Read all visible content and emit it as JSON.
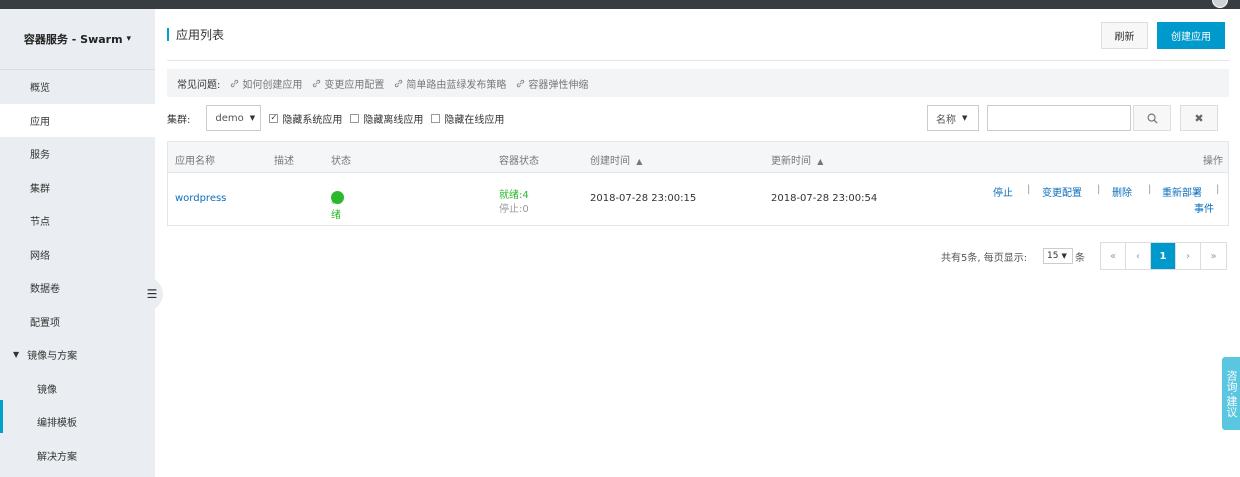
{
  "sidebar": {
    "title": "容器服务 - Swarm",
    "items": [
      "概览",
      "应用",
      "服务",
      "集群",
      "节点",
      "网络",
      "数据卷",
      "配置项"
    ],
    "group": "镜像与方案",
    "subitems": [
      "镜像",
      "编排模板",
      "解决方案"
    ]
  },
  "header": {
    "title": "应用列表",
    "refresh": "刷新",
    "create": "创建应用"
  },
  "faq": {
    "label": "常见问题:",
    "links": [
      "如何创建应用",
      "变更应用配置",
      "简单路由蓝绿发布策略",
      "容器弹性伸缩"
    ]
  },
  "filter": {
    "cluster_label": "集群:",
    "cluster_value": "demo",
    "checks": [
      {
        "label": "隐藏系统应用",
        "checked": true
      },
      {
        "label": "隐藏离线应用",
        "checked": false
      },
      {
        "label": "隐藏在线应用",
        "checked": false
      }
    ],
    "search_type": "名称",
    "search_value": ""
  },
  "table": {
    "headers": {
      "name": "应用名称",
      "desc": "描述",
      "status": "状态",
      "container": "容器状态",
      "created": "创建时间",
      "updated": "更新时间",
      "ops": "操作"
    },
    "row": {
      "name": "wordpress",
      "status": "就绪",
      "ready": "就绪:4",
      "stopped": "停止:0",
      "created": "2018-07-28 23:00:15",
      "updated": "2018-07-28 23:00:54",
      "actions": [
        "停止",
        "变更配置",
        "删除",
        "重新部署",
        "事件"
      ]
    }
  },
  "pager": {
    "total": "共有5条,",
    "per_page": "每页显示:",
    "size": "15",
    "unit": "条",
    "first": "«",
    "prev": "‹",
    "current": "1",
    "next": "›",
    "last": "»"
  },
  "feedback": "咨询·建议",
  "colors": {
    "accent": "#0099cc",
    "ok": "#2db82d",
    "sidebar": "#eaedf1"
  }
}
